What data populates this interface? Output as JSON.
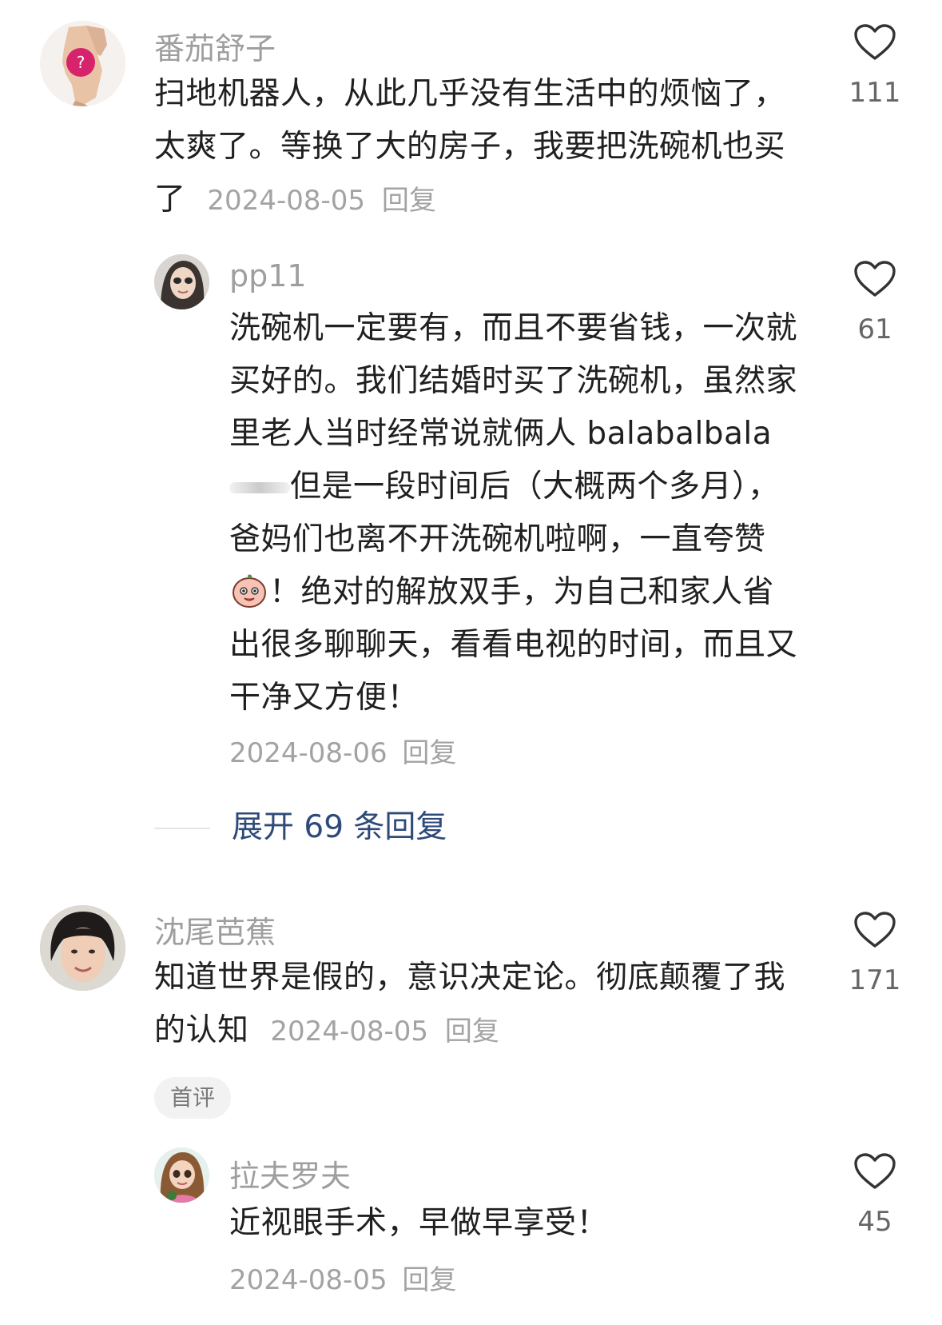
{
  "comments": [
    {
      "username": "番茄舒子",
      "text": "扫地机器人，从此几乎没有生活中的烦恼了，太爽了。等换了大的房子，我要把洗碗机也买了",
      "date": "2024-08-05",
      "reply_label": "回复",
      "likes": "111",
      "avatar": "hand-avatar",
      "replies": [
        {
          "username": "pp11",
          "text_before_blur": "洗碗机一定要有，而且不要省钱，一次就买好的。我们结婚时买了洗碗机，虽然家里老人当时经常说就俩人 balabalbala",
          "text_middle": "但是一段时间后（大概两个多月），爸妈们也离不开洗碗机啦啊，一直夸赞",
          "text_after_emoji": "！绝对的解放双手，为自己和家人省出很多聊聊天，看看电视的时间，而且又干净又方便！",
          "date": "2024-08-06",
          "reply_label": "回复",
          "likes": "61",
          "avatar": "woman-avatar",
          "emoji": "peach-face-emoji"
        }
      ],
      "expand_label": "展开 69 条回复"
    },
    {
      "username": "沈尾芭蕉",
      "text": "知道世界是假的，意识决定论。彻底颠覆了我的认知",
      "date": "2024-08-05",
      "reply_label": "回复",
      "likes": "171",
      "badge": "首评",
      "avatar": "short-hair-avatar",
      "replies": [
        {
          "username": "拉夫罗夫",
          "text": "近视眼手术，早做早享受！",
          "date": "2024-08-05",
          "reply_label": "回复",
          "likes": "45",
          "avatar": "cartoon-girl-avatar"
        }
      ]
    }
  ],
  "icons": {
    "like": "heart-outline-icon"
  },
  "colors": {
    "username": "#9e9e9e",
    "meta": "#a3a3a3",
    "expand_link": "#2f4a7a",
    "badge_bg": "#f2f2f2"
  }
}
